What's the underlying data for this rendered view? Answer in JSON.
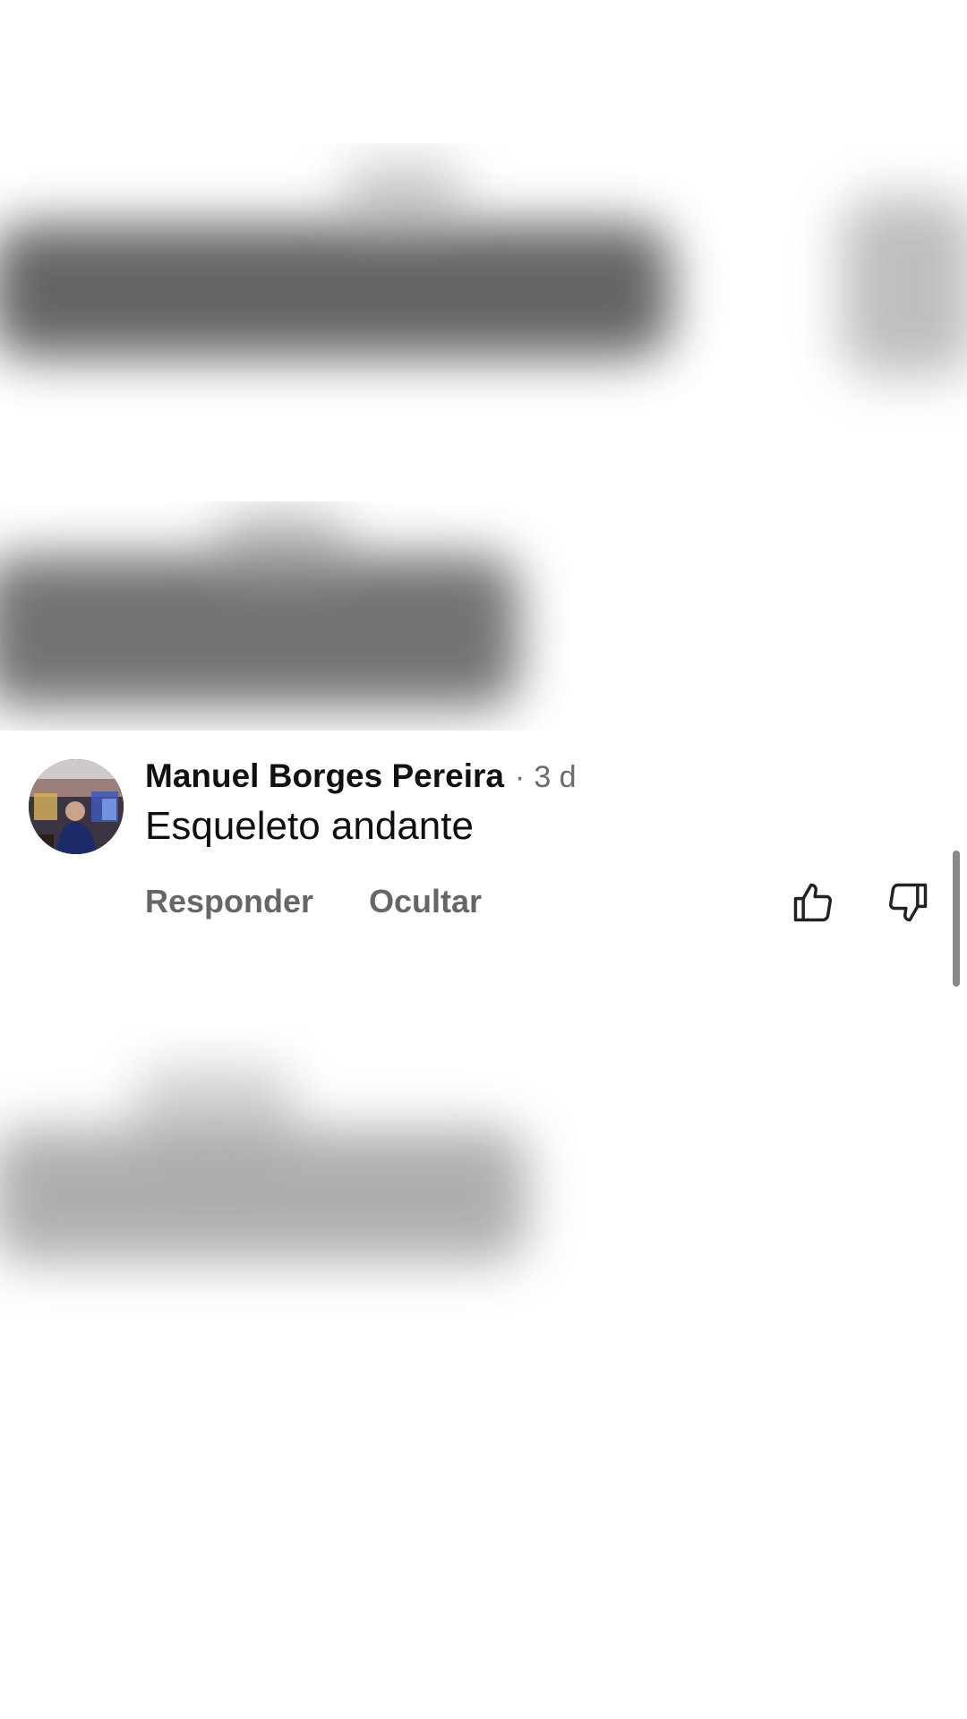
{
  "comment": {
    "author": "Manuel Borges Pereira",
    "separator": "·",
    "age": "3 d",
    "text": "Esqueleto andante",
    "avatar_icon": "user-avatar-photo",
    "actions": {
      "reply_label": "Responder",
      "hide_label": "Ocultar",
      "like_icon": "thumbs-up-icon",
      "dislike_icon": "thumbs-down-icon"
    }
  },
  "colors": {
    "author_text": "#111111",
    "secondary_text": "#6b6b6b",
    "action_text": "#666666",
    "background": "#ffffff"
  }
}
